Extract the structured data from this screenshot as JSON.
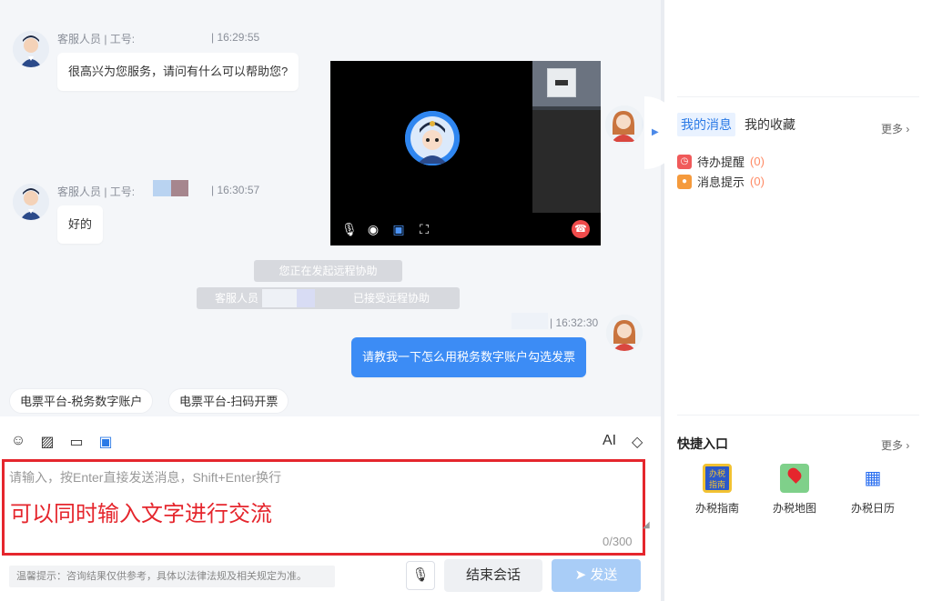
{
  "messages": [
    {
      "sender": "客服人员 | 工号:",
      "time": "| 16:29:55",
      "text": "很高兴为您服务，请问有什么可以帮助您?"
    },
    {
      "sender": "客服人员 | 工号:",
      "time": "| 16:30:57",
      "text": "好的"
    },
    {
      "time": "| 16:32:30",
      "text": "请教我一下怎么用税务数字账户勾选发票"
    }
  ],
  "system_messages": [
    "您正在发起远程协助",
    "客服人员",
    "已接受远程协助"
  ],
  "chips": [
    "电票平台-税务数字账户",
    "电票平台-扫码开票"
  ],
  "video": {
    "controls": [
      "mic-icon",
      "camera-icon",
      "screen-share-icon",
      "fullscreen-icon"
    ],
    "hangup_icon": "hangup-icon"
  },
  "right_panel": {
    "tabs": [
      "我的消息",
      "我的收藏"
    ],
    "more": "更多",
    "notices": [
      {
        "label": "待办提醒",
        "count": "(0)",
        "color": "#f05a5a"
      },
      {
        "label": "消息提示",
        "count": "(0)",
        "color": "#f59a3c"
      }
    ],
    "quick_title": "快捷入口",
    "quick_more": "更多",
    "quick_items": [
      {
        "label": "办税指南",
        "icon": "guide-icon",
        "icon_text": "办税指南"
      },
      {
        "label": "办税地图",
        "icon": "map-icon"
      },
      {
        "label": "办税日历",
        "icon": "calendar-icon"
      }
    ]
  },
  "composer": {
    "placeholder": "请输入，按Enter直接发送消息，Shift+Enter换行",
    "overlay": "可以同时输入文字进行交流",
    "counter": "0/300",
    "tip": "温馨提示：咨询结果仅供参考，具体以法律法规及相关规定为准。",
    "end_label": "结束会话",
    "send_label": "发送",
    "toolbar": [
      "emoji-icon",
      "image-icon",
      "folder-icon",
      "screen-share-icon"
    ],
    "font_toggle": "AI",
    "clear_icon": "eraser-icon"
  },
  "colors": {
    "accent": "#3c8cf5",
    "highlight": "#e5262d"
  }
}
